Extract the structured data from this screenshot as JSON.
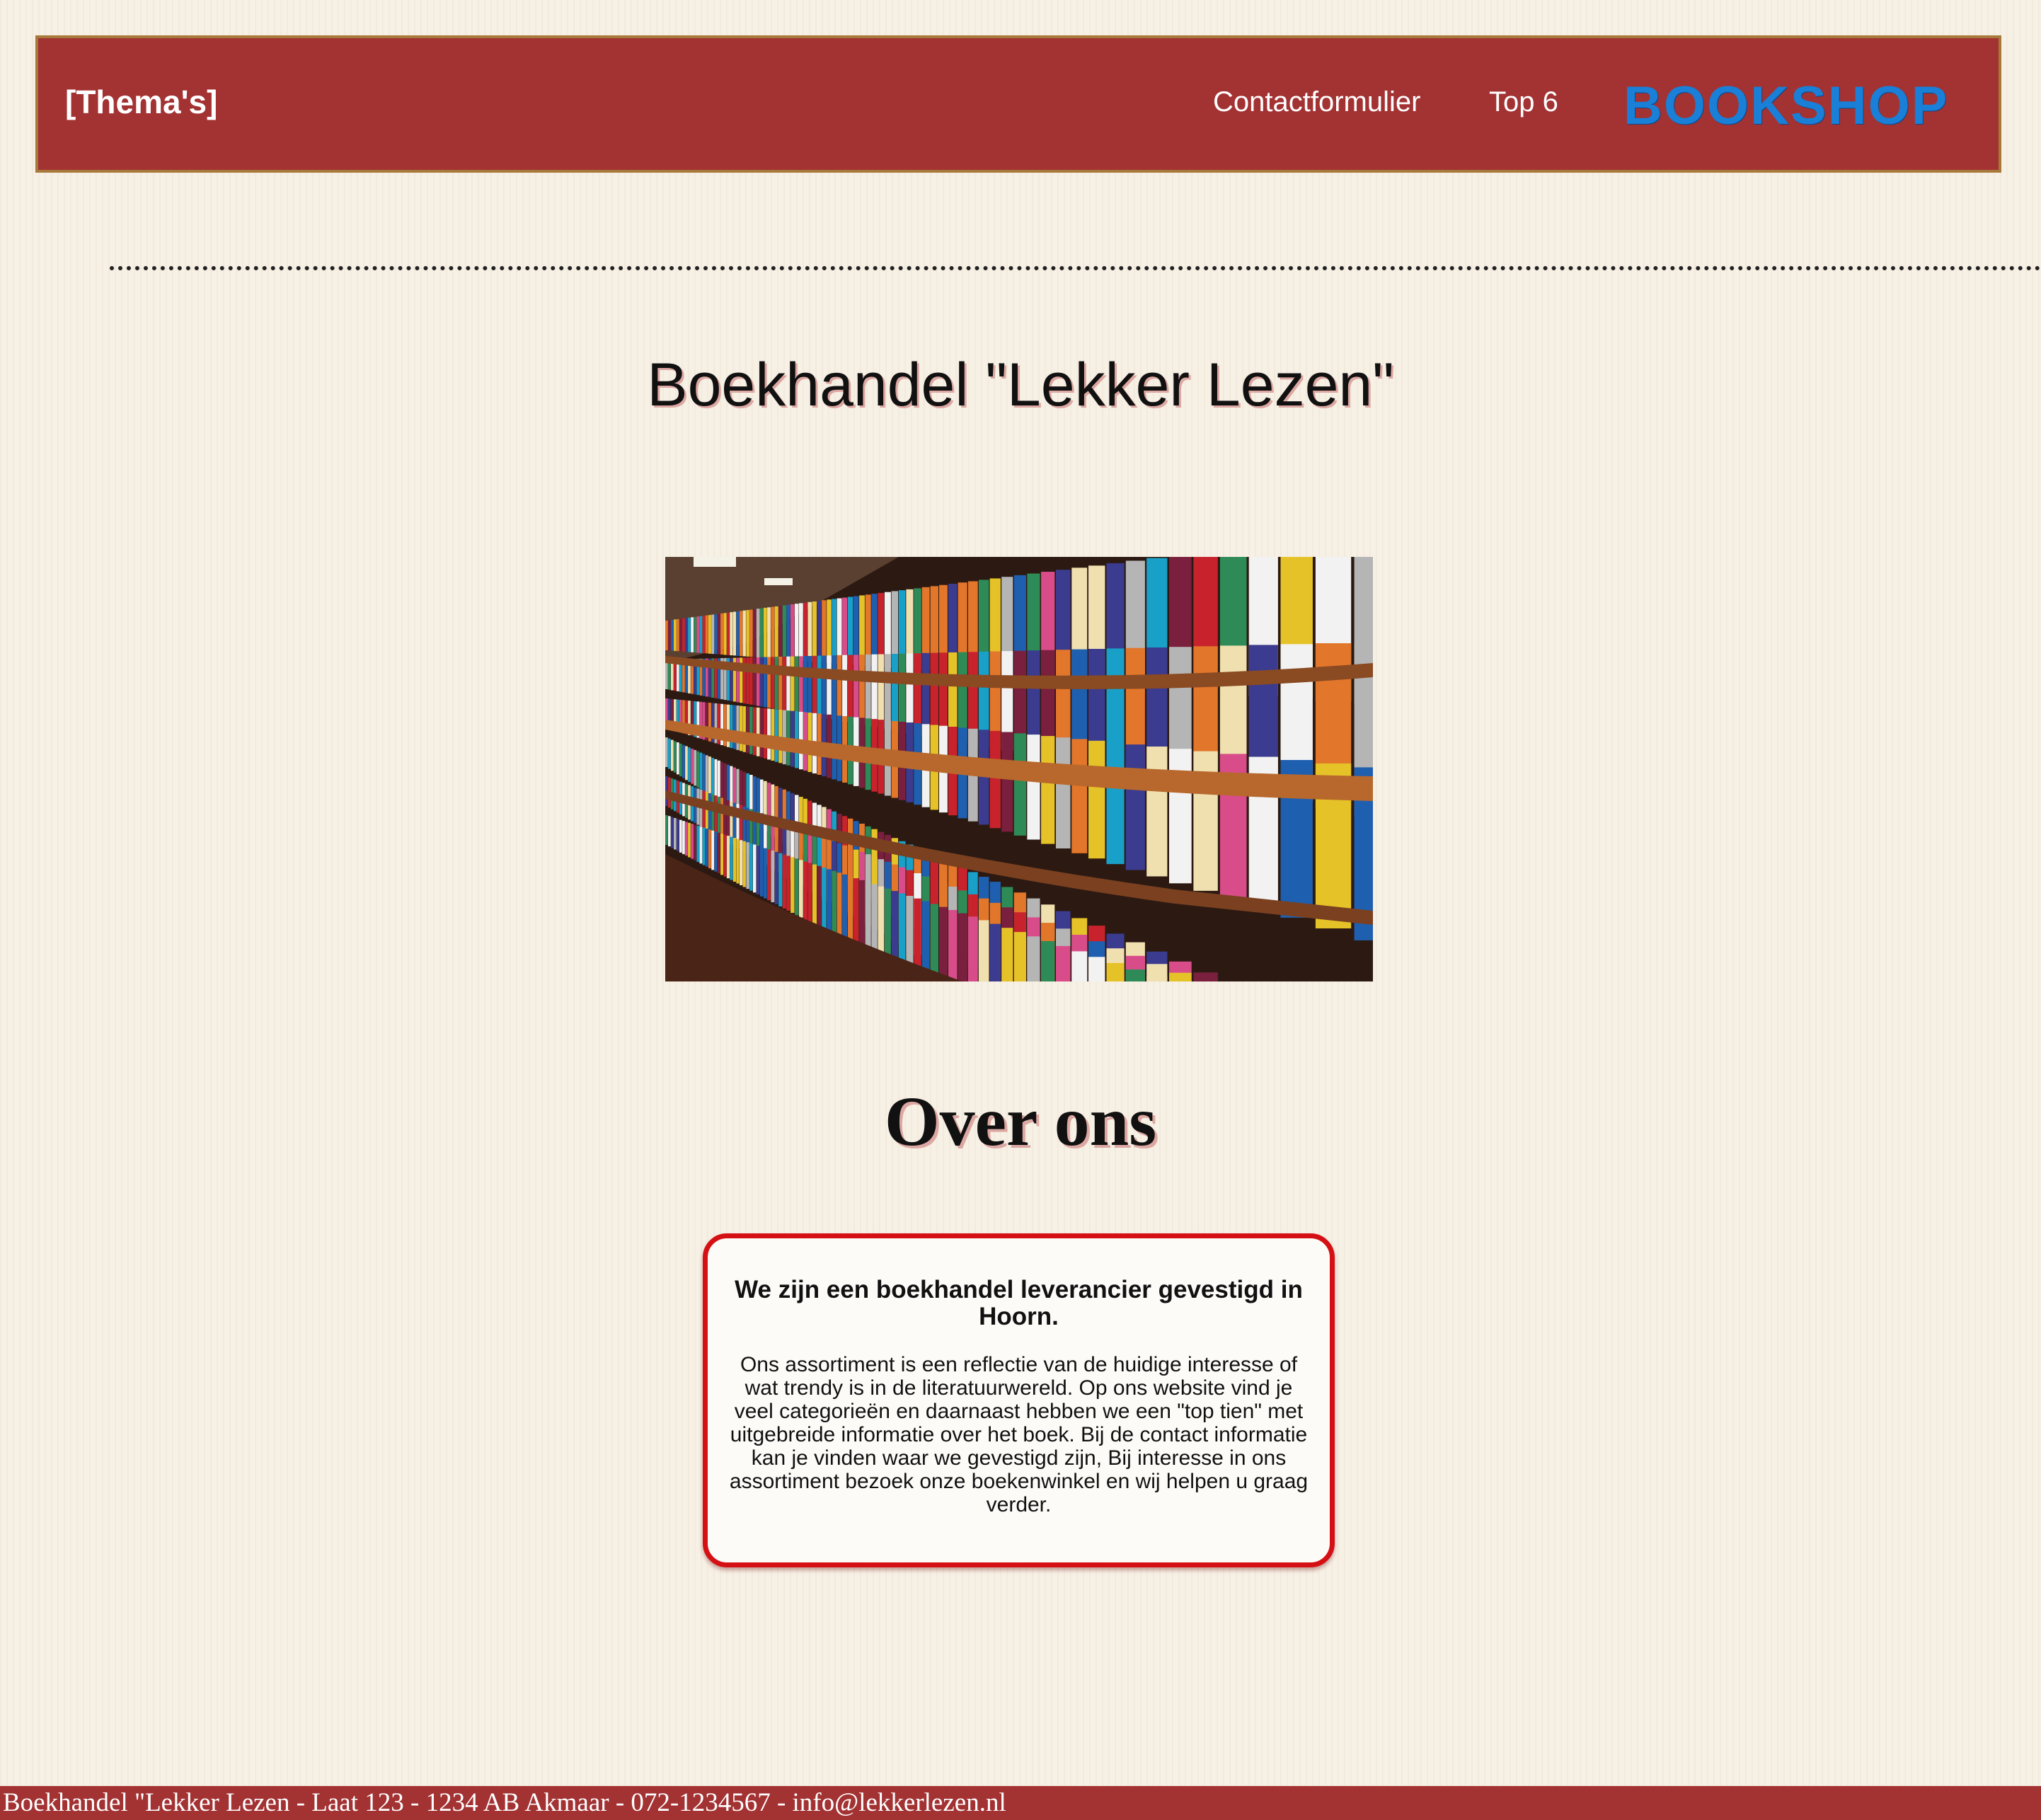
{
  "navbar": {
    "brand_label": "[Thema's]",
    "links": [
      {
        "label": "Contactformulier"
      },
      {
        "label": "Top 6"
      }
    ],
    "logo_text": "BOOKSHOP"
  },
  "main": {
    "title": "Boekhandel \"Lekker Lezen\"",
    "section_heading": "Over ons",
    "about": {
      "heading": "We zijn een boekhandel leverancier gevestigd in Hoorn.",
      "text": "Ons assortiment is een reflectie van de huidige interesse of wat trendy is in de literatuurwereld. Op ons website vind je veel categorieën en daarnaast hebben we een \"top tien\" met uitgebreide informatie over het boek. Bij de contact informatie kan je vinden waar we gevestigd zijn, Bij interesse in ons assortiment bezoek onze boekenwinkel en wij helpen u graag verder."
    }
  },
  "footer": {
    "text": "Boekhandel \"Lekker Lezen - Laat 123 - 1234 AB Akmaar - 072-1234567 - info@lekkerlezen.nl"
  },
  "colors": {
    "page_background": "#f7f0e5",
    "navbar_background": "#a33233",
    "navbar_border": "#a7793a",
    "logo": "#1a7fd6",
    "card_border": "#d51015",
    "footer_background": "#a33233"
  }
}
